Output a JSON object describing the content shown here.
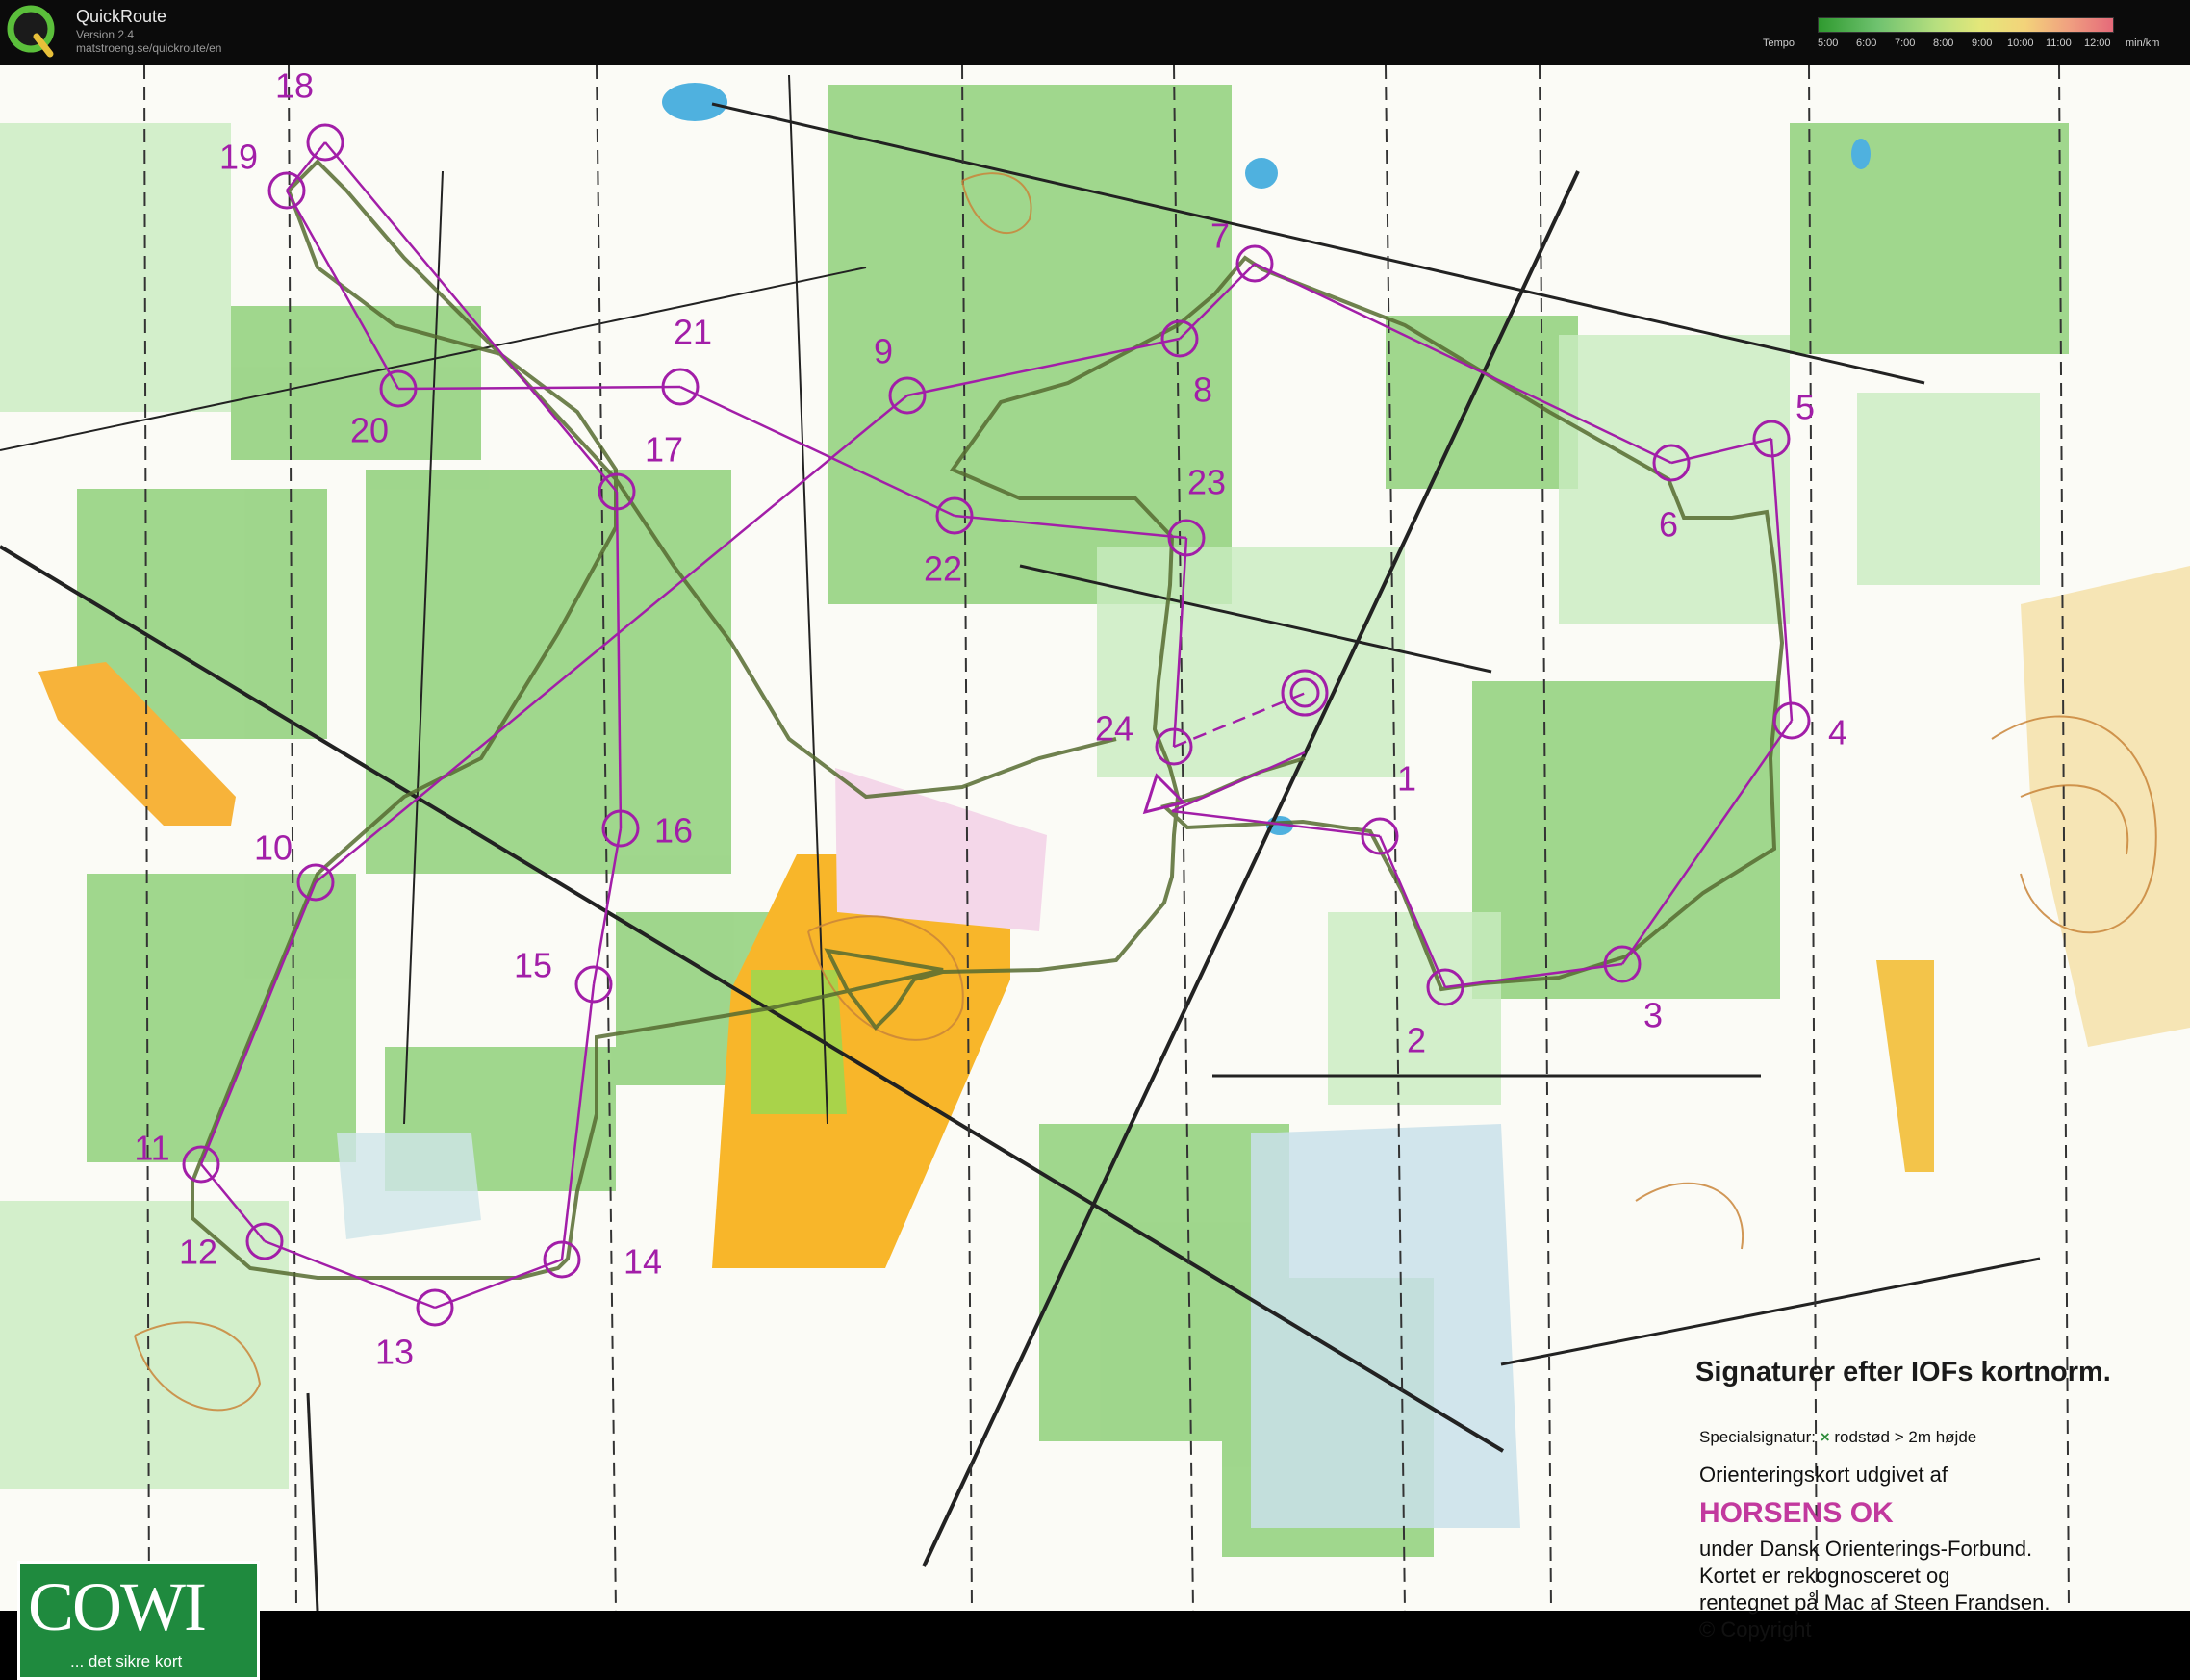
{
  "app": {
    "name": "QuickRoute",
    "version": "Version 2.4",
    "url": "matstroeng.se/quickroute/en"
  },
  "tempo_scale": {
    "label": "Tempo",
    "ticks": [
      "5:00",
      "6:00",
      "7:00",
      "8:00",
      "9:00",
      "10:00",
      "11:00",
      "12:00"
    ],
    "unit": "min/km",
    "colors": [
      "#2f9a2f",
      "#6fc26f",
      "#b7df7f",
      "#e4e77a",
      "#f3d37a",
      "#f0a080",
      "#e56a7a"
    ]
  },
  "map": {
    "course_color": "#a21ea8",
    "route_color": "#4c6b2f",
    "controls": [
      "1",
      "2",
      "3",
      "4",
      "5",
      "6",
      "7",
      "8",
      "9",
      "10",
      "11",
      "12",
      "13",
      "14",
      "15",
      "16",
      "17",
      "18",
      "19",
      "20",
      "21",
      "22",
      "23",
      "24"
    ]
  },
  "legend": {
    "title": "Signaturer efter IOFs kortnorm.",
    "special_label": "Specialsignatur:",
    "special_marker": "×",
    "special_text": "rodstød > 2m højde",
    "publisher_line": "Orienteringskort udgivet af",
    "club": "HORSENS OK",
    "line1": "under Dansk Orienterings-Forbund.",
    "line2": "Kortet er rekognosceret og",
    "line3": "rentegnet på Mac af Steen Frandsen.",
    "line4": "© Copyright"
  },
  "cowi": {
    "logo_text": "COWI",
    "tagline": "... det sikre kort"
  }
}
